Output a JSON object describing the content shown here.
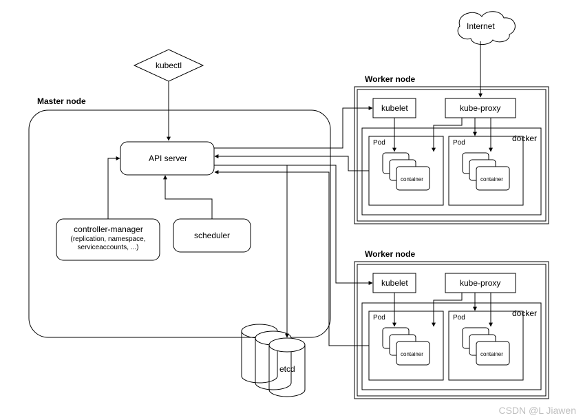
{
  "cloud": {
    "label": "Internet"
  },
  "kubectl": {
    "label": "kubectl"
  },
  "master": {
    "title": "Master node",
    "api": "API server",
    "controller": {
      "title": "controller-manager",
      "sub": "(replication, namespace,\nserviceaccounts, ...)"
    },
    "scheduler": "scheduler",
    "etcd": "etcd"
  },
  "worker1": {
    "title": "Worker node",
    "kubelet": "kubelet",
    "kubeproxy": "kube-proxy",
    "docker": "docker",
    "pod": "Pod",
    "container": "container"
  },
  "worker2": {
    "title": "Worker node",
    "kubelet": "kubelet",
    "kubeproxy": "kube-proxy",
    "docker": "docker",
    "pod": "Pod",
    "container": "container"
  },
  "watermark": "CSDN @L Jiawen"
}
